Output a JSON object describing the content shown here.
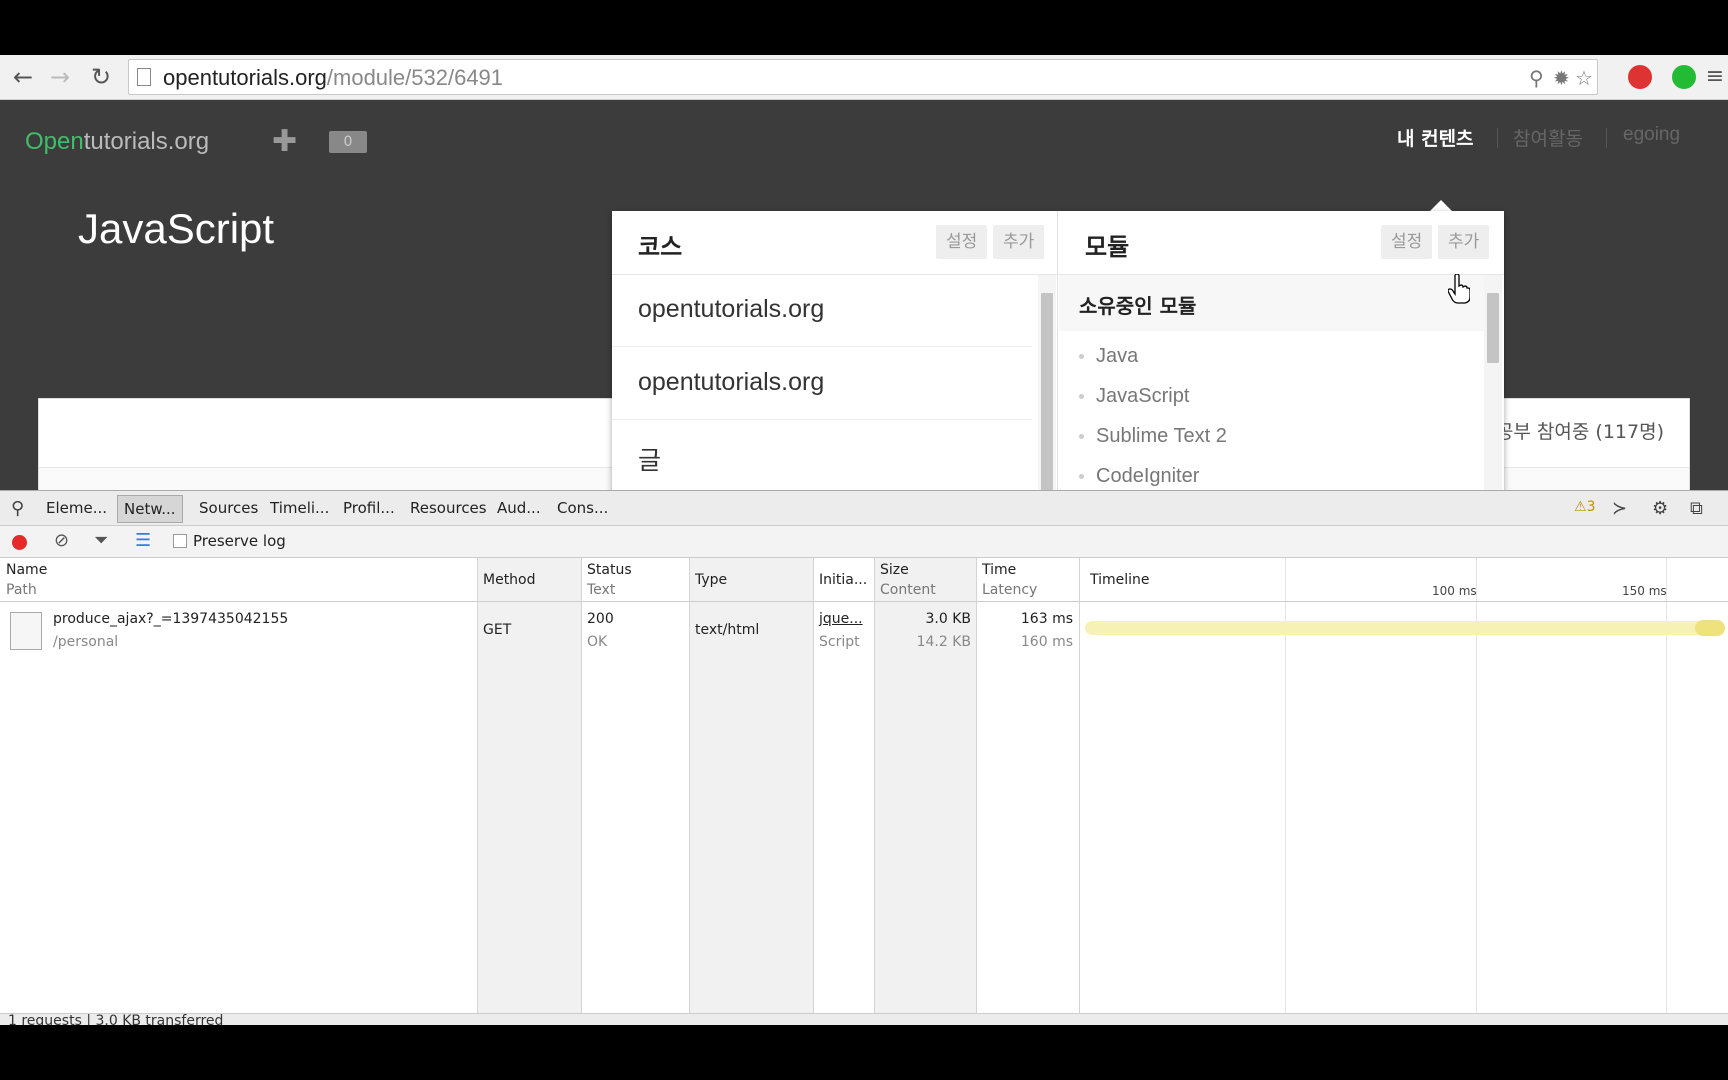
{
  "browser": {
    "url_host": "opentutorials.org",
    "url_path": "/module/532/6491"
  },
  "site": {
    "logo_accent": "Open",
    "logo_rest": "tutorials.org",
    "plus_label": "✚",
    "count_badge": "0",
    "menu": {
      "my_content": "내 컨텐츠",
      "activity": "참여활동",
      "user": "egoing"
    },
    "module_title": "JavaScript",
    "card_right_text": "공부 참여중 (117명)"
  },
  "dropdown": {
    "course": {
      "title": "코스",
      "settings_label": "설정",
      "add_label": "추가",
      "items": [
        {
          "label": "opentutorials.org"
        },
        {
          "label": "opentutorials.org"
        },
        {
          "label": "글"
        }
      ]
    },
    "module": {
      "title": "모듈",
      "settings_label": "설정",
      "add_label": "추가",
      "owned_header": "소유중인 모듈",
      "items": [
        {
          "label": "Java"
        },
        {
          "label": "JavaScript"
        },
        {
          "label": "Sublime Text 2"
        },
        {
          "label": "CodeIgniter"
        }
      ]
    }
  },
  "devtools": {
    "tabs": [
      {
        "label": "Eleme..."
      },
      {
        "label": "Netw..."
      },
      {
        "label": "Sources"
      },
      {
        "label": "Timeli..."
      },
      {
        "label": "Profil..."
      },
      {
        "label": "Resources"
      },
      {
        "label": "Aud..."
      },
      {
        "label": "Cons..."
      }
    ],
    "warnings_count": "3",
    "preserve_log_label": "Preserve log",
    "columns": {
      "name": {
        "main": "Name",
        "sub": "Path"
      },
      "method": {
        "main": "Method"
      },
      "status": {
        "main": "Status",
        "sub": "Text"
      },
      "type": {
        "main": "Type"
      },
      "initiator": {
        "main": "Initia..."
      },
      "size": {
        "main": "Size",
        "sub": "Content"
      },
      "time": {
        "main": "Time",
        "sub": "Latency"
      },
      "timeline": {
        "main": "Timeline"
      }
    },
    "timeline_ticks": [
      {
        "label": "100 ms"
      },
      {
        "label": "150 ms"
      }
    ],
    "rows": [
      {
        "name": "produce_ajax?_=1397435042155",
        "path": "/personal",
        "method": "GET",
        "status": "200",
        "status_text": "OK",
        "type": "text/html",
        "initiator": "jque...",
        "initiator_sub": "Script",
        "size": "3.0 KB",
        "content": "14.2 KB",
        "time": "163 ms",
        "latency": "160 ms"
      }
    ],
    "status_summary": "1 requests | 3.0 KB transferred"
  },
  "colors": {
    "site_bg": "#3c3c3c",
    "logo_accent": "#3fbf6a",
    "record": "#e62a2a",
    "timeline_bar": "#f6f1b4"
  }
}
